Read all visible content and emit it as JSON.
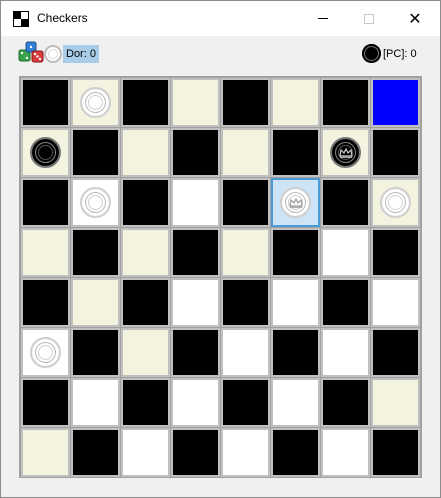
{
  "window": {
    "title": "Checkers"
  },
  "titlebar": {
    "close_glyph": "✕"
  },
  "status": {
    "player_label": "Dor: 0",
    "pc_label": "[PC]: 0"
  },
  "board": {
    "rows": [
      [
        {
          "color": "black"
        },
        {
          "color": "cream",
          "piece": "white"
        },
        {
          "color": "black"
        },
        {
          "color": "cream"
        },
        {
          "color": "black"
        },
        {
          "color": "cream"
        },
        {
          "color": "black"
        },
        {
          "color": "blue"
        }
      ],
      [
        {
          "color": "cream",
          "piece": "black"
        },
        {
          "color": "black"
        },
        {
          "color": "cream"
        },
        {
          "color": "black"
        },
        {
          "color": "cream"
        },
        {
          "color": "black"
        },
        {
          "color": "cream",
          "piece": "black",
          "king": true
        },
        {
          "color": "black"
        }
      ],
      [
        {
          "color": "black"
        },
        {
          "color": "white",
          "piece": "white"
        },
        {
          "color": "black"
        },
        {
          "color": "white"
        },
        {
          "color": "black"
        },
        {
          "color": "selected",
          "piece": "white",
          "king": true
        },
        {
          "color": "black"
        },
        {
          "color": "cream",
          "piece": "white"
        }
      ],
      [
        {
          "color": "cream"
        },
        {
          "color": "black"
        },
        {
          "color": "cream"
        },
        {
          "color": "black"
        },
        {
          "color": "cream"
        },
        {
          "color": "black"
        },
        {
          "color": "white"
        },
        {
          "color": "black"
        }
      ],
      [
        {
          "color": "black"
        },
        {
          "color": "cream"
        },
        {
          "color": "black"
        },
        {
          "color": "white"
        },
        {
          "color": "black"
        },
        {
          "color": "white"
        },
        {
          "color": "black"
        },
        {
          "color": "white"
        }
      ],
      [
        {
          "color": "white",
          "piece": "white"
        },
        {
          "color": "black"
        },
        {
          "color": "cream"
        },
        {
          "color": "black"
        },
        {
          "color": "white"
        },
        {
          "color": "black"
        },
        {
          "color": "white"
        },
        {
          "color": "black"
        }
      ],
      [
        {
          "color": "black"
        },
        {
          "color": "white"
        },
        {
          "color": "black"
        },
        {
          "color": "white"
        },
        {
          "color": "black"
        },
        {
          "color": "white"
        },
        {
          "color": "black"
        },
        {
          "color": "cream"
        }
      ],
      [
        {
          "color": "cream"
        },
        {
          "color": "black"
        },
        {
          "color": "white"
        },
        {
          "color": "black"
        },
        {
          "color": "white"
        },
        {
          "color": "black"
        },
        {
          "color": "white"
        },
        {
          "color": "black"
        }
      ]
    ]
  }
}
